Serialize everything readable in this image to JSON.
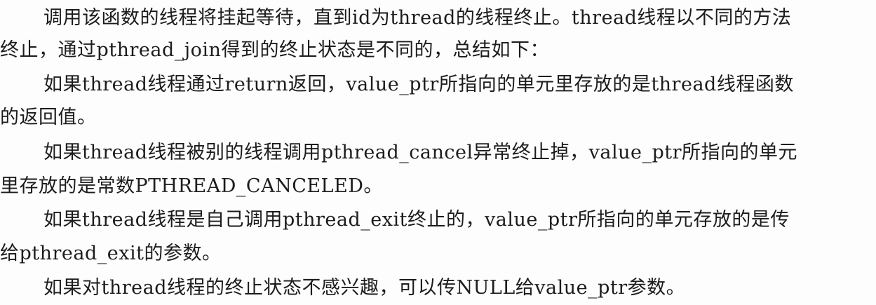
{
  "document": {
    "lines": [
      "调用该函数的线程将挂起等待，直到id为thread的线程终止。thread线程以不同的方法",
      "终止，通过pthread_join得到的终止状态是不同的，总结如下：",
      "如果thread线程通过return返回，value_ptr所指向的单元里存放的是thread线程函数",
      "的返回值。",
      "如果thread线程被别的线程调用pthread_cancel异常终止掉，value_ptr所指向的单元",
      "里存放的是常数PTHREAD_CANCELED。",
      "如果thread线程是自己调用pthread_exit终止的，value_ptr所指向的单元存放的是传",
      "给pthread_exit的参数。",
      "如果对thread线程的终止状态不感兴趣，可以传NULL给value_ptr参数。"
    ]
  }
}
